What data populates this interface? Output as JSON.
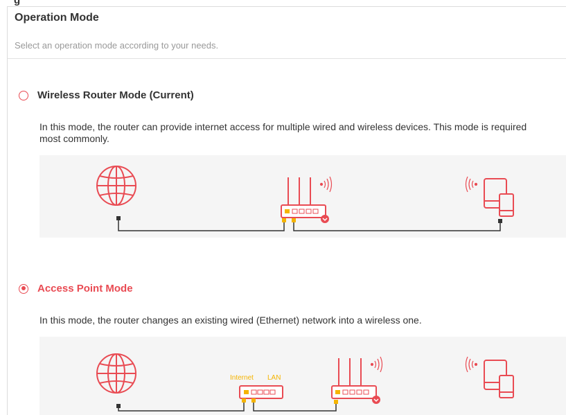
{
  "header_cut_text": "g",
  "title": "Operation Mode",
  "subtitle": "Select an operation mode according to your needs.",
  "modes": [
    {
      "label": "Wireless Router Mode (Current)",
      "selected": false,
      "description": "In this mode, the router can provide internet access for multiple wired and wireless devices. This mode is required most commonly."
    },
    {
      "label": "Access Point Mode",
      "selected": true,
      "description": "In this mode, the router changes an existing wired (Ethernet) network into a wireless one."
    }
  ],
  "ap_diagram": {
    "internet_label": "Internet",
    "lan_label": "LAN"
  },
  "colors": {
    "accent": "#e94b53",
    "port_yellow": "#f5b400",
    "line": "#333333",
    "diagram_bg": "#f5f5f5"
  },
  "icons": [
    "globe-icon",
    "router-icon",
    "wifi-signal-icon",
    "tablet-phone-icon",
    "switch-icon"
  ]
}
